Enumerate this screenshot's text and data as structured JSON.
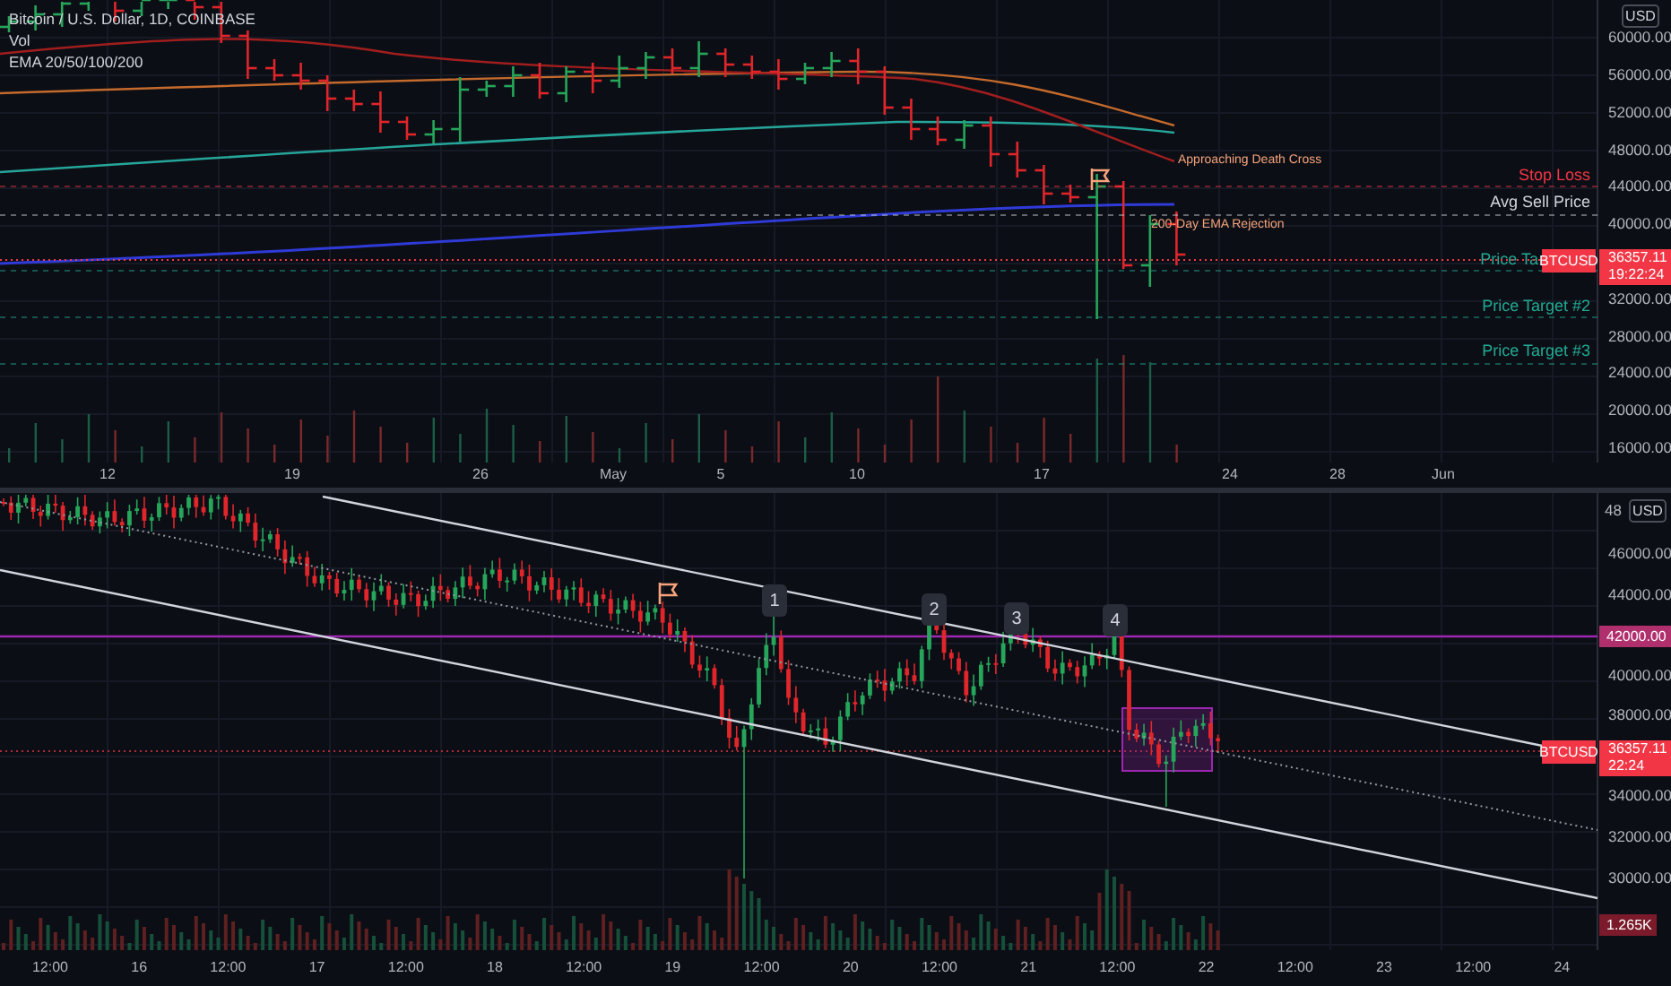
{
  "legend": {
    "symbol": "Bitcoin / U.S. Dollar, 1D, COINBASE",
    "volume": "Vol",
    "indicator": "EMA 20/50/100/200"
  },
  "top_chart": {
    "currency": "USD",
    "price_labels": [
      "60000.00",
      "56000.00",
      "52000.00",
      "48000.00",
      "44000.00",
      "40000.00",
      "32000.00",
      "28000.00",
      "24000.00",
      "20000.00",
      "16000.00"
    ],
    "time_labels": [
      "12",
      "19",
      "26",
      "May",
      "5",
      "10",
      "17",
      "24",
      "28",
      "Jun"
    ],
    "annotations": [
      {
        "kind": "text",
        "text": "Approaching Death Cross"
      },
      {
        "kind": "flag"
      },
      {
        "kind": "text",
        "text": "200-Day EMA Rejection"
      }
    ],
    "levels": [
      {
        "label": "Stop Loss",
        "color": "#f23645"
      },
      {
        "label": "Avg Sell Price",
        "color": "#d1d4dc"
      },
      {
        "label": "Price Ta",
        "color": "#22ab94"
      },
      {
        "label": "Price Target #2",
        "color": "#22ab94"
      },
      {
        "label": "Price Target #3",
        "color": "#22ab94"
      }
    ],
    "last_price": {
      "symbol": "BTCUSD",
      "price": "36357.11",
      "countdown": "19:22:24"
    }
  },
  "bottom_chart": {
    "currency": "USD",
    "price_labels": [
      "48",
      "46000.00",
      "44000.00",
      "40000.00",
      "38000.00",
      "34000.00",
      "32000.00",
      "30000.00"
    ],
    "highlight_level": "42000.00",
    "volume_label": "1.265K",
    "markers": [
      "1",
      "2",
      "3",
      "4"
    ],
    "time_labels": [
      "12:00",
      "16",
      "12:00",
      "17",
      "12:00",
      "18",
      "12:00",
      "19",
      "12:00",
      "20",
      "12:00",
      "21",
      "12:00",
      "22",
      "12:00",
      "23",
      "12:00",
      "24"
    ],
    "last_price": {
      "symbol": "BTCUSD",
      "price": "36357.11",
      "countdown": "22:24"
    }
  }
}
